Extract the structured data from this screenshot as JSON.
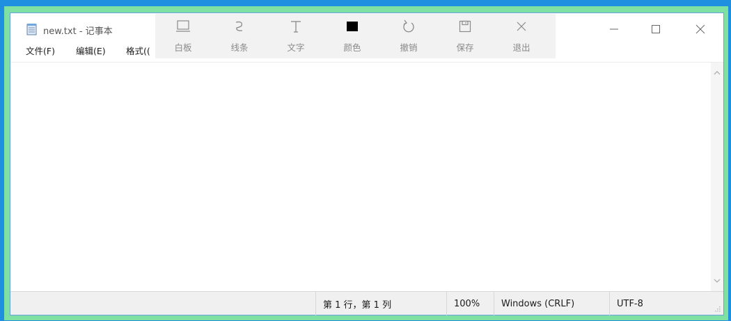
{
  "window": {
    "title": "new.txt - 记事本"
  },
  "menu": [
    {
      "label": "文件(F)"
    },
    {
      "label": "编辑(E)"
    },
    {
      "label": "格式(("
    }
  ],
  "toolbar": {
    "tools": [
      {
        "label": "白板",
        "icon": "whiteboard-icon"
      },
      {
        "label": "线条",
        "icon": "line-icon"
      },
      {
        "label": "文字",
        "icon": "text-icon"
      },
      {
        "label": "颜色",
        "icon": "color-icon",
        "color": "#000000"
      },
      {
        "label": "撤销",
        "icon": "undo-icon"
      },
      {
        "label": "保存",
        "icon": "save-icon"
      },
      {
        "label": "退出",
        "icon": "exit-icon"
      }
    ]
  },
  "editor": {
    "content": ""
  },
  "status": {
    "position": "第 1 行，第 1 列",
    "zoom": "100%",
    "line_ending": "Windows (CRLF)",
    "encoding": "UTF-8"
  },
  "colors": {
    "desktop": "#1f8fe0",
    "frame_highlight": "#7ee0a2",
    "toolbar_bg": "#f2f2f2",
    "status_bg": "#f0f0f0"
  }
}
